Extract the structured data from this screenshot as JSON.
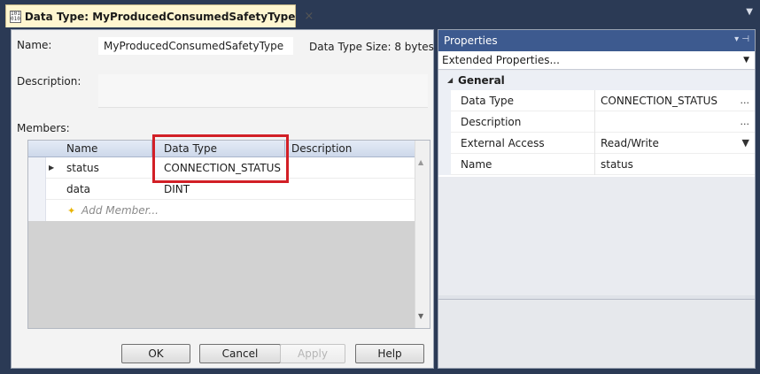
{
  "tab": {
    "title": "Data Type: MyProducedConsumedSafetyType",
    "close": "×",
    "icon": "data-type-icon",
    "icon_text": "101\n010"
  },
  "form": {
    "name_label": "Name:",
    "name_value": "MyProducedConsumedSafetyType",
    "size_text": "Data Type Size: 8 bytes",
    "description_label": "Description:",
    "members_label": "Members:"
  },
  "grid": {
    "columns": [
      "Name",
      "Data Type",
      "Description"
    ],
    "rows": [
      {
        "name": "status",
        "data_type": "CONNECTION_STATUS",
        "expandable": true
      },
      {
        "name": "data",
        "data_type": "DINT",
        "expandable": false
      }
    ],
    "add_member": "Add Member..."
  },
  "buttons": {
    "ok": "OK",
    "cancel": "Cancel",
    "apply": "Apply",
    "help": "Help"
  },
  "properties": {
    "title": "Properties",
    "selector": "Extended Properties...",
    "category": "General",
    "rows": [
      {
        "name": "Data Type",
        "value": "CONNECTION_STATUS",
        "button": "..."
      },
      {
        "name": "Description",
        "value": "",
        "button": "..."
      },
      {
        "name": "External Access",
        "value": "Read/Write",
        "button": "▼"
      },
      {
        "name": "Name",
        "value": "status",
        "button": ""
      }
    ]
  },
  "colors": {
    "frame": "#2b3a55",
    "tab": "#fff6d0",
    "properties_header": "#3d5a8f",
    "highlight": "#d21f26"
  }
}
